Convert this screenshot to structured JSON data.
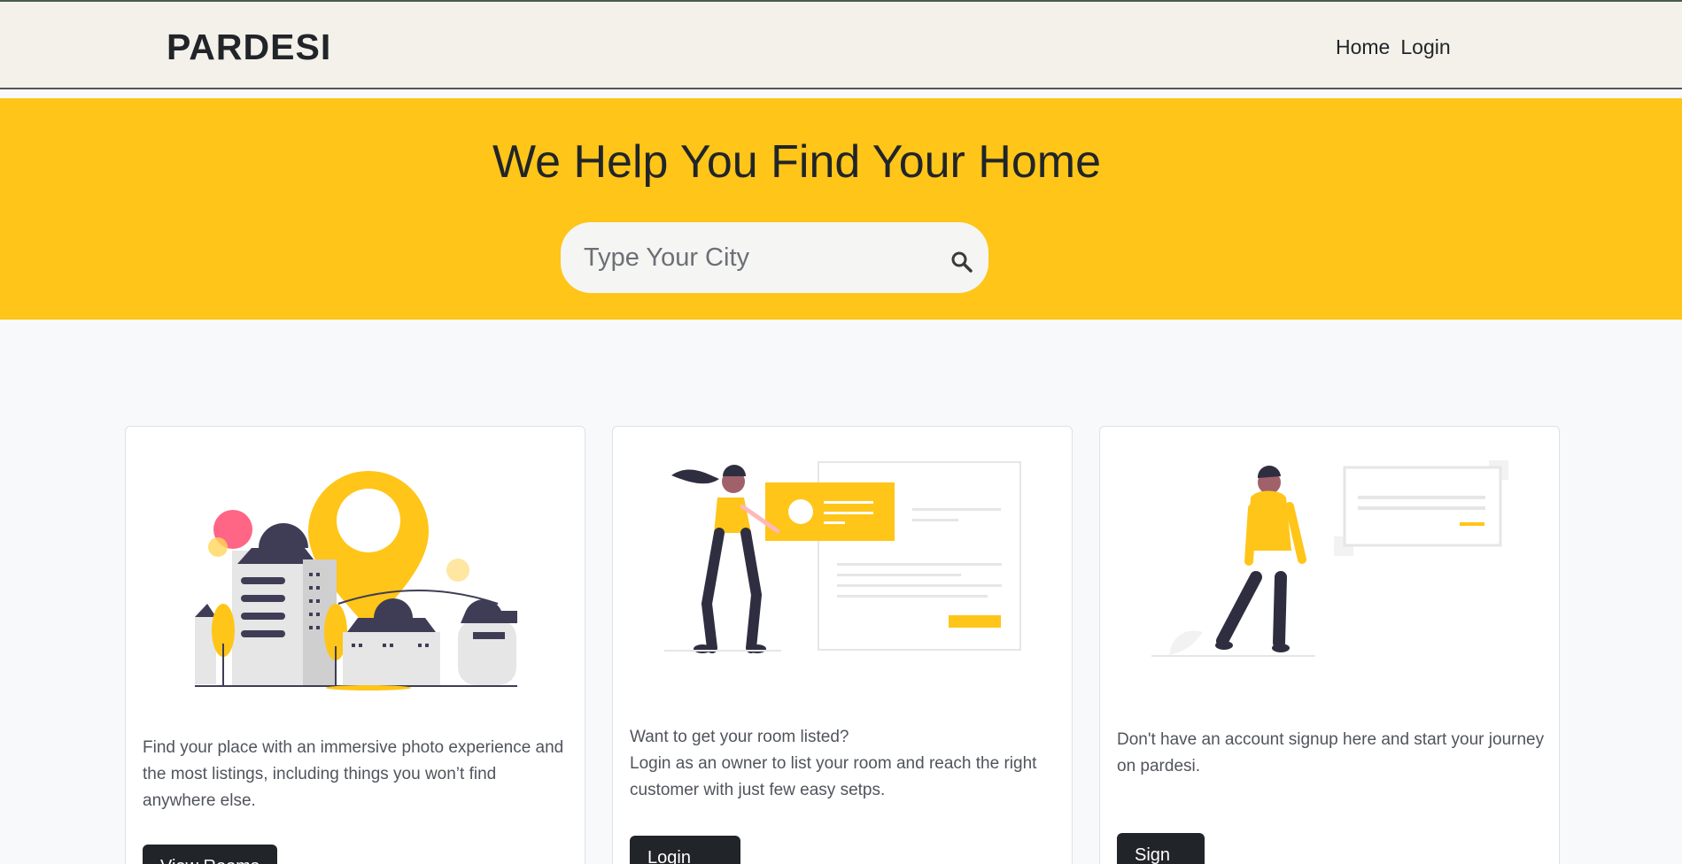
{
  "navbar": {
    "brand": "PARDESI",
    "links": [
      {
        "label": "Home"
      },
      {
        "label": "Login"
      }
    ]
  },
  "hero": {
    "title": "We Help You Find Your Home",
    "search": {
      "placeholder": "Type Your City",
      "icon": "search-icon"
    }
  },
  "cards": [
    {
      "illustration": "city-location-illustration",
      "text": "Find your place with an immersive photo experience and the most listings, including things you won’t find anywhere else.",
      "button_label": "View Rooms"
    },
    {
      "illustration": "woman-with-listing-card-illustration",
      "text_line1": "Want to get your room listed?",
      "text_line2": "Login as an owner to list your room and reach the right customer with just few easy setps.",
      "button_label": "Login"
    },
    {
      "illustration": "man-walking-illustration",
      "text": "Don't have an account signup here and start your journey on pardesi.",
      "button_label": "Sign up"
    }
  ],
  "colors": {
    "accent_yellow": "#ffc518",
    "navbar_bg": "#f4f1ea",
    "dark": "#212529",
    "figure_dark": "#3f3d56",
    "pink": "#ff6584"
  }
}
